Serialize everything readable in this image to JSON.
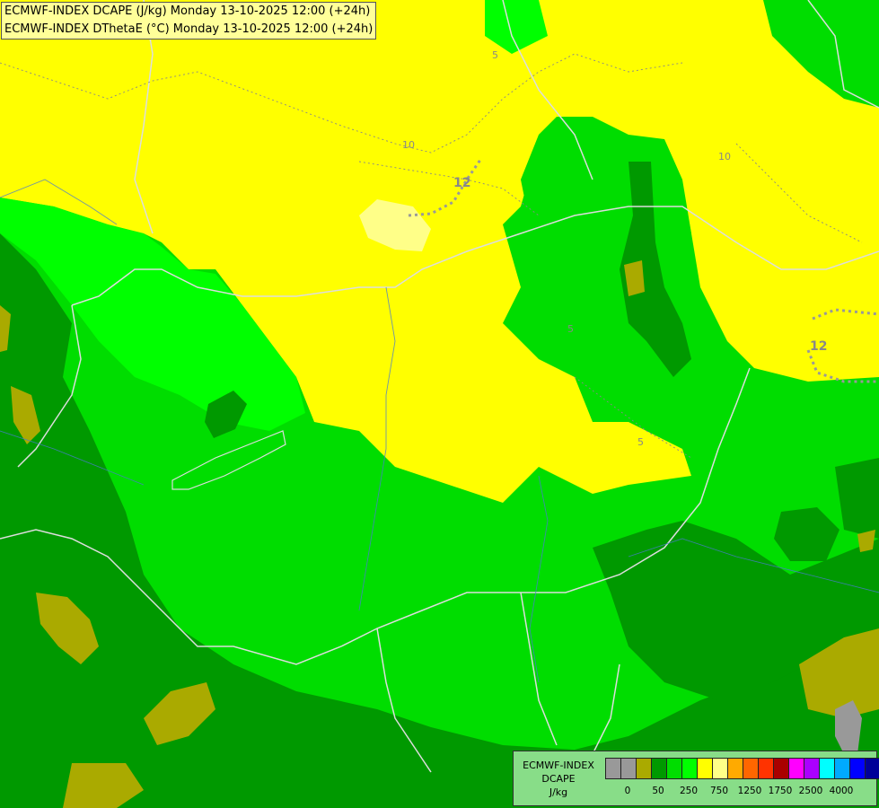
{
  "titles": {
    "line1": "ECMWF-INDEX DCAPE (J/kg) Monday 13-10-2025 12:00 (+24h)",
    "line2": "ECMWF-INDEX DThetaE (°C) Monday 13-10-2025 12:00 (+24h)"
  },
  "legend": {
    "model": "ECMWF-INDEX",
    "parameter": "DCAPE",
    "unit": "J/kg",
    "colors": [
      "#999999",
      "#999999",
      "#aaaa00",
      "#009900",
      "#00dd00",
      "#00ff00",
      "#ffff00",
      "#ffff88",
      "#ffaa00",
      "#ff6600",
      "#ff3300",
      "#aa0000",
      "#ff00ff",
      "#aa00ff",
      "#00ffff",
      "#00aaff",
      "#0000ff",
      "#000099"
    ],
    "tick_labels": [
      "0",
      "50",
      "250",
      "750",
      "1250",
      "1750",
      "2500",
      "4000"
    ]
  },
  "contour_labels": [
    "5",
    "10",
    "10",
    "12",
    "12",
    "5",
    "5"
  ],
  "map_colors": {
    "dark_green": "#009900",
    "green": "#00dd00",
    "bright_green": "#00ff00",
    "yellow": "#ffff00",
    "light_yellow": "#ffff88",
    "olive": "#aaaa00",
    "gray": "#999999"
  }
}
